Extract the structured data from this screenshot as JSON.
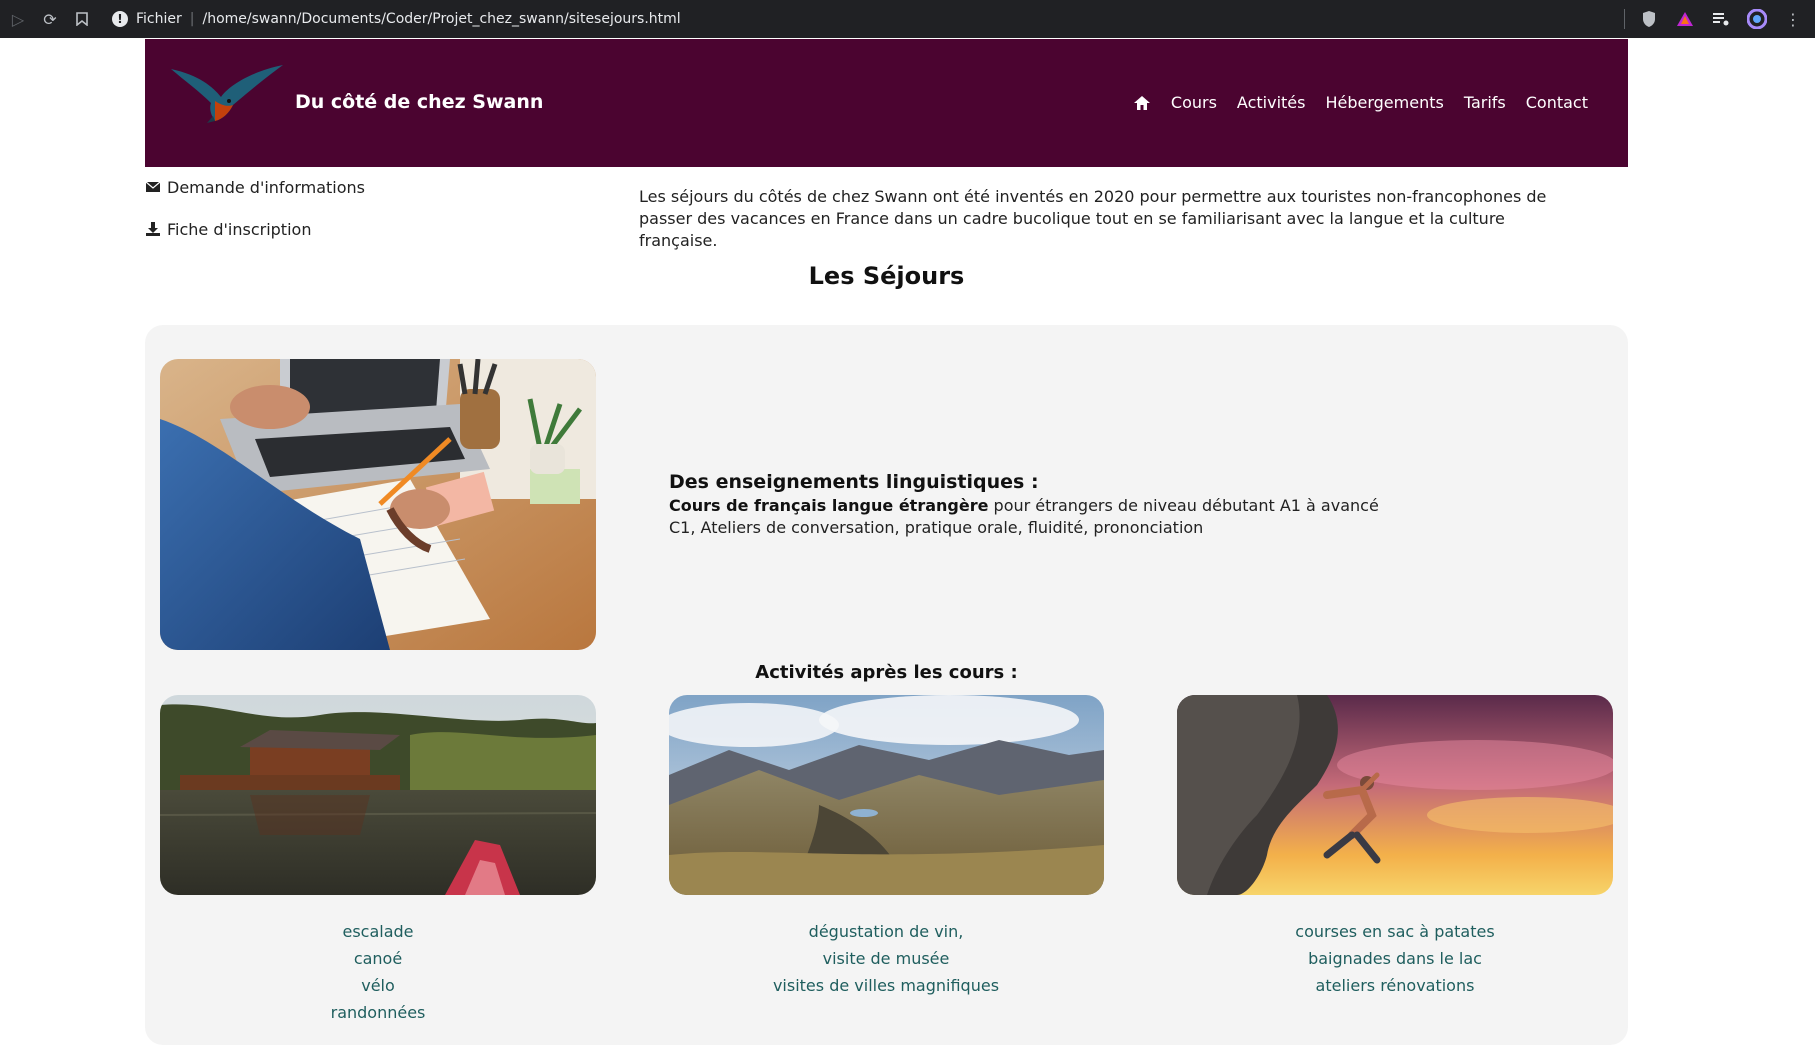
{
  "browser": {
    "scheme_label": "Fichier",
    "url": "/home/swann/Documents/Coder/Projet_chez_swann/sitesejours.html"
  },
  "header": {
    "site_title": "Du côté de chez Swann",
    "nav": [
      "Cours",
      "Activités",
      "Hébergements",
      "Tarifs",
      "Contact"
    ]
  },
  "sidebar": {
    "info_link": "Demande d'informations",
    "form_link": "Fiche d'inscription"
  },
  "intro": "Les séjours du côtés de chez Swann ont été inventés en 2020 pour permettre aux touristes non-francophones de passer des vacances en France dans un cadre bucolique tout en se familiarisant avec la langue et la culture française.",
  "page_title": "Les Séjours",
  "teaching": {
    "title": "Des enseignements linguistiques :",
    "bold": "Cours de français langue étrangère",
    "rest": " pour étrangers de niveau débutant A1 à avancé C1, Ateliers de conversation, pratique orale, fluidité, prononciation"
  },
  "activities": {
    "title": "Activités après les cours :",
    "col1": [
      "escalade",
      "canoé",
      "vélo",
      "randonnées"
    ],
    "col2": [
      "dégustation de vin,",
      "visite de musée",
      "visites de villes magnifiques"
    ],
    "col3": [
      "courses en sac à patates",
      "baignades dans le lac",
      "ateliers rénovations"
    ]
  },
  "colors": {
    "header_bg": "#4b0430",
    "activity_text": "#1f5e5e",
    "panel_bg": "#f4f4f4"
  }
}
